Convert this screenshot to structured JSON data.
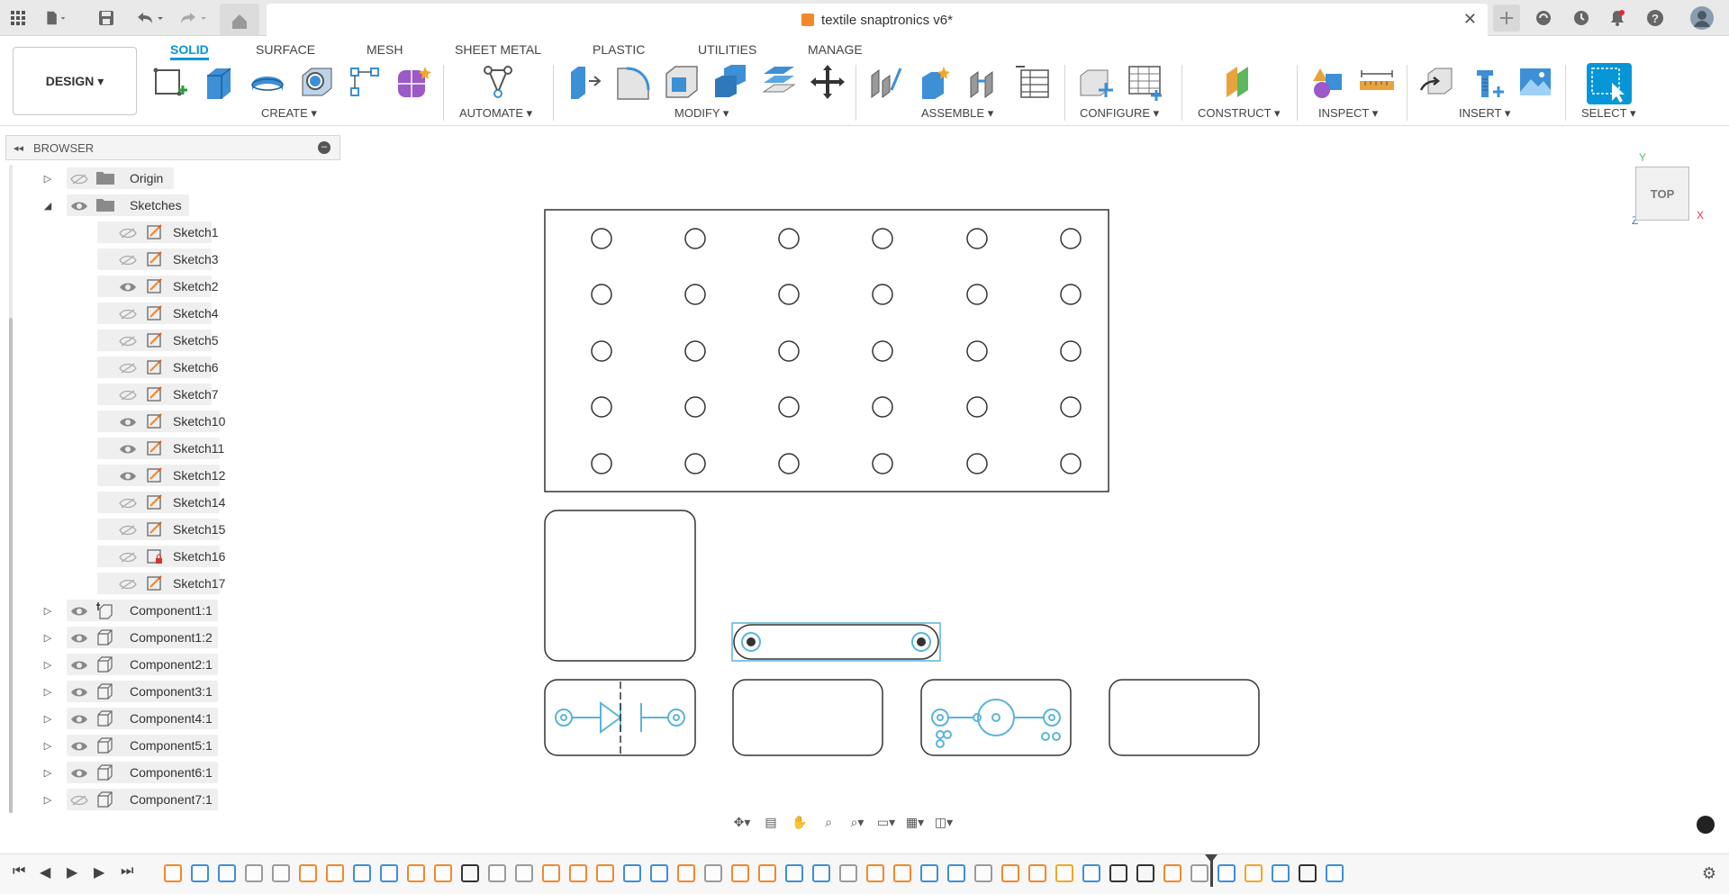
{
  "titlebar": {
    "document_title": "textile snaptronics v6*",
    "close_glyph": "✕"
  },
  "toolbar": {
    "workspace_button": "DESIGN ▾",
    "tabs": [
      "SOLID",
      "SURFACE",
      "MESH",
      "SHEET METAL",
      "PLASTIC",
      "UTILITIES",
      "MANAGE"
    ],
    "active_tab": "SOLID",
    "groups": [
      "CREATE ▾",
      "AUTOMATE ▾",
      "MODIFY ▾",
      "ASSEMBLE ▾",
      "CONFIGURE ▾",
      "CONSTRUCT ▾",
      "INSPECT ▾",
      "INSERT ▾",
      "SELECT ▾"
    ]
  },
  "browser": {
    "title": "BROWSER",
    "items": [
      {
        "label": "Origin",
        "level": 0,
        "expanded": false,
        "visible": false,
        "icon": "folder-icon"
      },
      {
        "label": "Sketches",
        "level": 0,
        "expanded": true,
        "visible": true,
        "icon": "folder-icon"
      },
      {
        "label": "Sketch1",
        "level": 1,
        "visible": false,
        "icon": "sketch-icon"
      },
      {
        "label": "Sketch3",
        "level": 1,
        "visible": false,
        "icon": "sketch-icon"
      },
      {
        "label": "Sketch2",
        "level": 1,
        "visible": true,
        "icon": "sketch-icon"
      },
      {
        "label": "Sketch4",
        "level": 1,
        "visible": false,
        "icon": "sketch-icon"
      },
      {
        "label": "Sketch5",
        "level": 1,
        "visible": false,
        "icon": "sketch-icon"
      },
      {
        "label": "Sketch6",
        "level": 1,
        "visible": false,
        "icon": "sketch-icon"
      },
      {
        "label": "Sketch7",
        "level": 1,
        "visible": false,
        "icon": "sketch-icon"
      },
      {
        "label": "Sketch10",
        "level": 1,
        "visible": true,
        "icon": "sketch-icon"
      },
      {
        "label": "Sketch11",
        "level": 1,
        "visible": true,
        "icon": "sketch-icon"
      },
      {
        "label": "Sketch12",
        "level": 1,
        "visible": true,
        "icon": "sketch-icon"
      },
      {
        "label": "Sketch14",
        "level": 1,
        "visible": false,
        "icon": "sketch-icon"
      },
      {
        "label": "Sketch15",
        "level": 1,
        "visible": false,
        "icon": "sketch-icon"
      },
      {
        "label": "Sketch16",
        "level": 1,
        "visible": false,
        "icon": "sketch-locked-icon"
      },
      {
        "label": "Sketch17",
        "level": 1,
        "visible": false,
        "icon": "sketch-icon"
      },
      {
        "label": "Component1:1",
        "level": 0,
        "expanded": false,
        "visible": true,
        "icon": "component-anchor-icon"
      },
      {
        "label": "Component1:2",
        "level": 0,
        "expanded": false,
        "visible": true,
        "icon": "component-icon"
      },
      {
        "label": "Component2:1",
        "level": 0,
        "expanded": false,
        "visible": true,
        "icon": "component-icon"
      },
      {
        "label": "Component3:1",
        "level": 0,
        "expanded": false,
        "visible": true,
        "icon": "component-icon"
      },
      {
        "label": "Component4:1",
        "level": 0,
        "expanded": false,
        "visible": true,
        "icon": "component-icon"
      },
      {
        "label": "Component5:1",
        "level": 0,
        "expanded": false,
        "visible": true,
        "icon": "component-icon"
      },
      {
        "label": "Component6:1",
        "level": 0,
        "expanded": false,
        "visible": true,
        "icon": "component-icon"
      },
      {
        "label": "Component7:1",
        "level": 0,
        "expanded": false,
        "visible": false,
        "icon": "component-icon"
      }
    ]
  },
  "viewcube": {
    "face": "TOP",
    "axis_x": "X",
    "axis_y": "Y",
    "axis_z": "Z"
  },
  "colors": {
    "accent": "#0696d7",
    "sketch_line": "#333333",
    "selected": "#5ab4dc",
    "orange": "#f2882a"
  }
}
